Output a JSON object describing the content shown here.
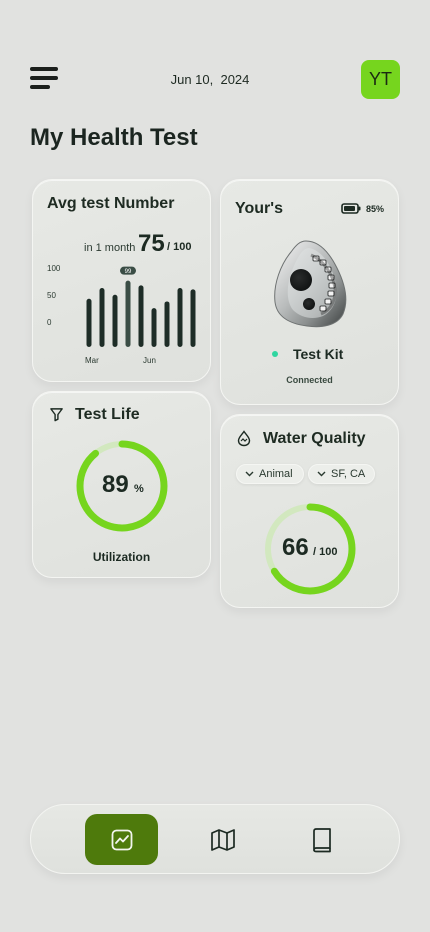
{
  "header": {
    "date": "Jun 10,  2024",
    "avatar_initials": "YT",
    "title": "My Health Test"
  },
  "avg_card": {
    "title": "Avg test Number",
    "period": "in 1 month",
    "value": "75",
    "value_suffix": "/ 100",
    "chart_data": {
      "type": "bar",
      "yticks": [
        "100",
        "50",
        "0"
      ],
      "xlabels": [
        "Mar",
        "Jun"
      ],
      "values": [
        72,
        88,
        78,
        99,
        92,
        58,
        68,
        88,
        86
      ],
      "ylim": [
        0,
        100
      ],
      "highlight_label": "99",
      "highlight_index": 3
    }
  },
  "kit_card": {
    "title": "Your's",
    "battery": "85%",
    "device_name": "Test Kit",
    "status": "Connected"
  },
  "life_card": {
    "title": "Test Life",
    "value": "89",
    "unit": "%",
    "label": "Utilization",
    "progress": 0.89
  },
  "water_card": {
    "title": "Water Quality",
    "filter_1": "Animal",
    "filter_2": "SF, CA",
    "value": "66",
    "suffix": "/ 100",
    "progress": 0.66
  },
  "nav": {
    "items": [
      "chart-icon",
      "map-icon",
      "book-icon"
    ],
    "active": "chart-icon"
  },
  "colors": {
    "accent": "#76d51e",
    "nav_active": "#4e7a0c",
    "bar": "#1e2d27",
    "status_dot": "#2fd6a0"
  }
}
